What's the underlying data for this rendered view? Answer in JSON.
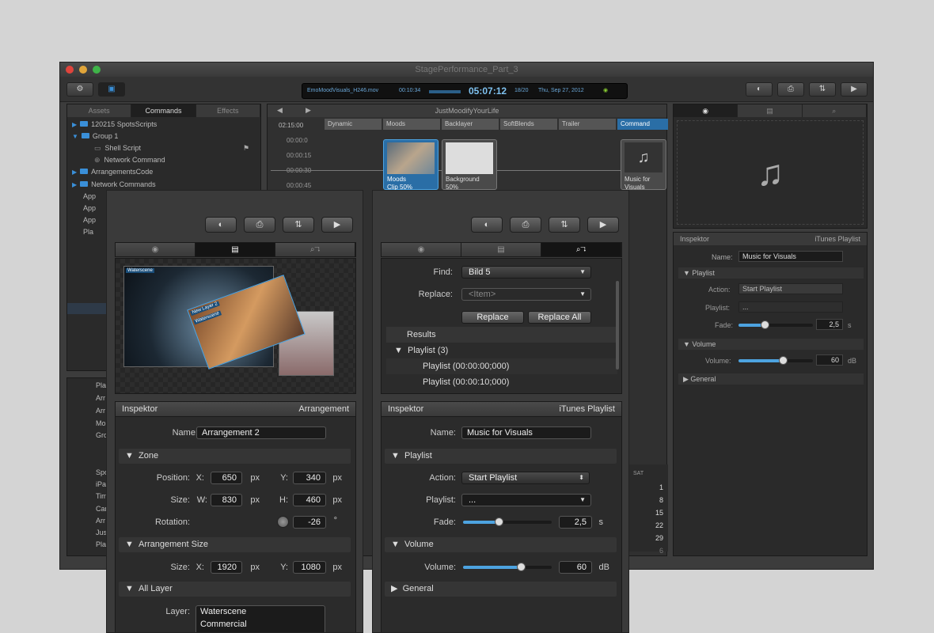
{
  "window": {
    "title": "StagePerformance_Part_3",
    "lcd": {
      "file": "EmoMoodVisuals_H246.mov",
      "elapsed": "00:10:34",
      "time": "05:07:12",
      "progress": "18/20",
      "date": "Thu, Sep 27, 2012"
    }
  },
  "left_tabs": [
    "Assets",
    "Commands",
    "Effects"
  ],
  "tree": [
    {
      "label": "120215 SpotsScripts",
      "indent": 0
    },
    {
      "label": "Group 1",
      "indent": 0
    },
    {
      "label": "Shell Script",
      "indent": 1
    },
    {
      "label": "Network Command",
      "indent": 1
    },
    {
      "label": "ArrangementsCode",
      "indent": 0
    },
    {
      "label": "Network Commands",
      "indent": 0
    }
  ],
  "tree_partial": [
    "App",
    "App",
    "App",
    "Pla"
  ],
  "lower_list": [
    "Pla",
    "Arr",
    "Arr",
    "Mo",
    "Gro",
    "Spo",
    "iPa",
    "Tim",
    "Can",
    "Arr",
    "Jus",
    "Pla"
  ],
  "timeline": {
    "title": "JustMoodifyYourLife",
    "start": "02:15:00",
    "tracks": [
      "Dynamic",
      "Moods",
      "Backlayer",
      "SoftBlends",
      "Trailer",
      "Command"
    ],
    "times": [
      "00:00:0",
      "00:00:15",
      "00:00:30",
      "00:00:45"
    ],
    "clips": [
      {
        "title": "Moods",
        "sub": "Clip 50%"
      },
      {
        "title": "Background",
        "sub": "50%"
      },
      {
        "title": "Music for",
        "sub": "Visuals"
      }
    ]
  },
  "calendar": {
    "header": "SAT",
    "days": [
      "1",
      "8",
      "15",
      "22",
      "29",
      "6"
    ]
  },
  "right_inspector": {
    "title": "Inspektor",
    "kind": "iTunes Playlist",
    "name_label": "Name:",
    "name": "Music for Visuals",
    "sec_playlist": "Playlist",
    "action_label": "Action:",
    "action": "Start Playlist",
    "playlist_label": "Playlist:",
    "playlist": "...",
    "fade_label": "Fade:",
    "fade": "2,5",
    "fade_unit": "s",
    "fade_level": 0.35,
    "sec_volume": "Volume",
    "volume_label": "Volume:",
    "volume": "60",
    "volume_unit": "dB",
    "volume_level": 0.6,
    "sec_general": "General"
  },
  "panel_left": {
    "preview_labels": [
      "Waterscene",
      "New Layer 2",
      "Waterscene"
    ],
    "inspector_title": "Inspektor",
    "inspector_kind": "Arrangement",
    "name_label": "Name:",
    "name": "Arrangement 2",
    "sec_zone": "Zone",
    "position_label": "Position:",
    "x_label": "X:",
    "pos_x": "650",
    "y_label": "Y:",
    "pos_y": "340",
    "px": "px",
    "size_label": "Size:",
    "w_label": "W:",
    "size_w": "830",
    "h_label": "H:",
    "size_h": "460",
    "rotation_label": "Rotation:",
    "rotation": "-26",
    "deg": "°",
    "sec_arrsize": "Arrangement Size",
    "arr_size_label": "Size:",
    "arr_x": "1920",
    "arr_y": "1080",
    "sec_layer": "All Layer",
    "layer_label": "Layer:",
    "layers": [
      "Waterscene",
      "Commercial"
    ]
  },
  "panel_right": {
    "find_label": "Find:",
    "find": "Bild 5",
    "replace_label": "Replace:",
    "replace_placeholder": "<Item>",
    "replace_btn": "Replace",
    "replace_all_btn": "Replace All",
    "results": "Results",
    "playlist_group": "Playlist (3)",
    "results_items": [
      "Playlist (00:00:00;000)",
      "Playlist (00:00:10;000)"
    ],
    "inspector_title": "Inspektor",
    "inspector_kind": "iTunes Playlist",
    "name_label": "Name:",
    "name": "Music for Visuals",
    "sec_playlist": "Playlist",
    "action_label": "Action:",
    "action": "Start Playlist",
    "playlist_label": "Playlist:",
    "playlist": "...",
    "fade_label": "Fade:",
    "fade": "2,5",
    "fade_unit": "s",
    "fade_level": 0.4,
    "sec_volume": "Volume",
    "volume_label": "Volume:",
    "volume": "60",
    "volume_unit": "dB",
    "volume_level": 0.65,
    "sec_general": "General"
  },
  "colors": {
    "accent": "#3a8fd8",
    "traffic_red": "#e0443c",
    "traffic_yellow": "#e0a53a",
    "traffic_green": "#3fb449"
  }
}
